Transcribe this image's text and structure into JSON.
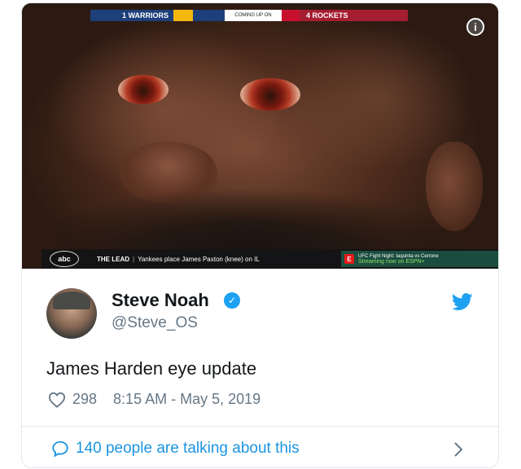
{
  "scoreboard": {
    "home_team": "1 WARRIORS",
    "coming_up": "COMING UP ON",
    "away_team": "4 ROCKETS"
  },
  "ticker": {
    "network": "abc",
    "label": "THE LEAD",
    "headline": "Yankees place James Paxton (knee) on IL",
    "promo_line1": "UFC Fight Night: Iaquinta vs Cerrone",
    "promo_line2": "Streaming now on ESPN+"
  },
  "info_button_glyph": "i",
  "tweet": {
    "author_name": "Steve Noah",
    "author_handle": "@Steve_OS",
    "verified": true,
    "text": "James Harden eye update",
    "like_count": "298",
    "timestamp": "8:15 AM - May 5, 2019",
    "conversation": "140 people are talking about this"
  },
  "colors": {
    "accent": "#1da1f2",
    "link": "#1b95e0",
    "muted": "#657786",
    "text": "#14171a",
    "warriors": "#1d3f7a",
    "rockets": "#a51d31"
  },
  "icons": [
    "info-icon",
    "verified-icon",
    "twitter-bird-icon",
    "heart-icon",
    "speech-bubble-icon",
    "chevron-right-icon",
    "abc-logo-icon"
  ]
}
